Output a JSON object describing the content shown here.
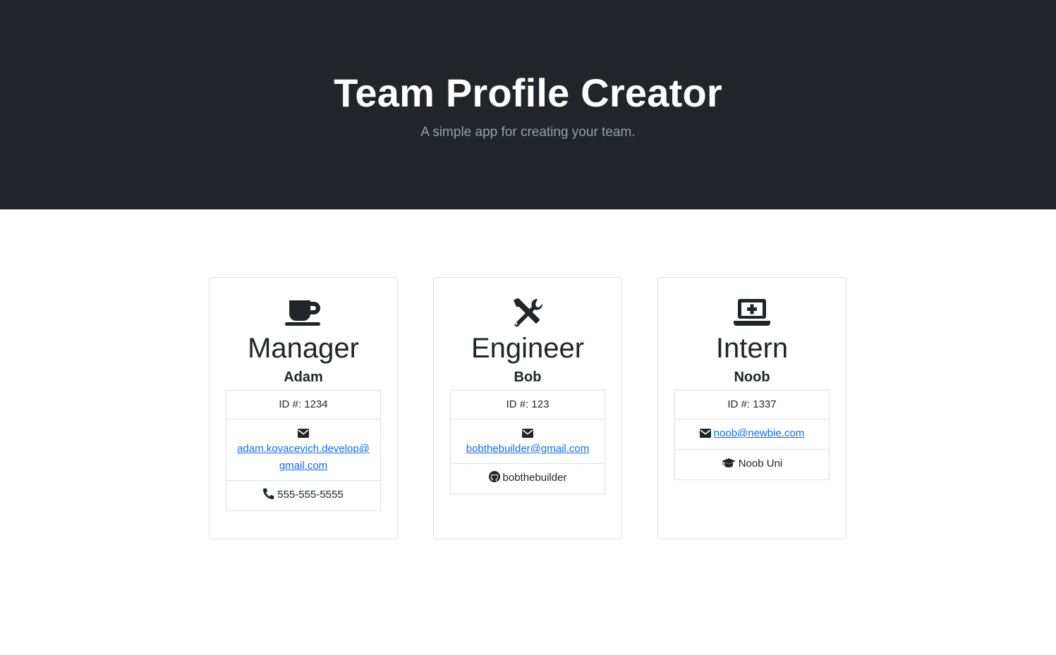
{
  "header": {
    "title": "Team Profile Creator",
    "subtitle": "A simple app for creating your team."
  },
  "cards": [
    {
      "role": "Manager",
      "role_icon": "coffee-icon",
      "name": "Adam",
      "id_text": "ID #: 1234",
      "email": "adam.kovacevich.develop@gmail.com",
      "extra_icon": "phone-icon",
      "extra_text": "555-555-5555"
    },
    {
      "role": "Engineer",
      "role_icon": "tools-icon",
      "name": "Bob",
      "id_text": "ID #: 123",
      "email": "bobthebuilder@gmail.com",
      "extra_icon": "github-icon",
      "extra_text": "bobthebuilder"
    },
    {
      "role": "Intern",
      "role_icon": "laptop-medical-icon",
      "name": "Noob",
      "id_text": "ID #: 1337",
      "email": "noob@newbie.com",
      "extra_icon": "graduation-cap-icon",
      "extra_text": "Noob Uni"
    }
  ],
  "colors": {
    "header_bg": "#212529",
    "link": "#0d6efd",
    "border": "#dee2e6"
  }
}
